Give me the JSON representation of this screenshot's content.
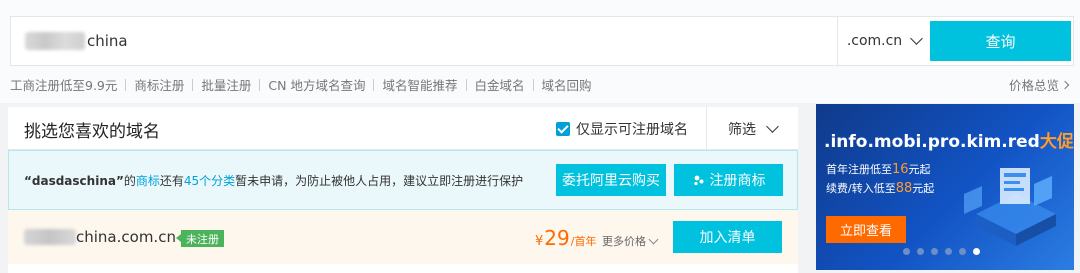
{
  "search": {
    "value": "china",
    "suffix": ".com.cn",
    "button_label": "查询"
  },
  "quicklinks": [
    "工商注册低至9.9元",
    "商标注册",
    "批量注册",
    "CN 地方域名查询",
    "域名智能推荐",
    "白金域名",
    "域名回购"
  ],
  "price_overview": "价格总览",
  "panel": {
    "title": "挑选您喜欢的域名",
    "only_available_label": "仅显示可注册域名",
    "filter_label": "筛选"
  },
  "notice": {
    "domain_quote": "“dasdaschina”",
    "t1": "的",
    "trademark": "商标",
    "t2": "还有",
    "classes": "45个分类",
    "t3": "暂未申请，为防止被他人占用，建议立即注册进行保护",
    "trust_button": "委托阿里云购买",
    "register_tm_button": "注册商标"
  },
  "result": {
    "domain": "china.com.cn",
    "status": "未注册",
    "currency": "¥",
    "price": "29",
    "per": "/首年",
    "more_price": "更多价格",
    "add_button": "加入清单"
  },
  "banner": {
    "title": ".info.mobi.pro.kim.red",
    "promo": "大促",
    "l1_a": "首年注册低至",
    "l1_b": "16",
    "l1_c": "元起",
    "l2_a": "续费/转入低至",
    "l2_b": "88",
    "l2_c": "元起",
    "button": "立即查看",
    "carousel_count": 6,
    "carousel_active": 6
  },
  "colors": {
    "accent": "#00c1de",
    "orange": "#ff6a00",
    "badge_green": "#4db35b"
  }
}
